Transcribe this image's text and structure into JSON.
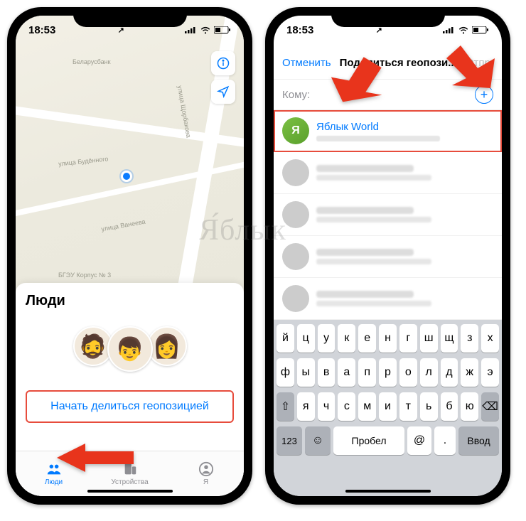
{
  "status": {
    "time": "18:53",
    "network_arrow": "↗"
  },
  "leftPhone": {
    "map": {
      "poi_bank": "Беларусбанк",
      "street1": "улица Будённого",
      "street2": "улица Ванеева",
      "street3": "улица Щорбакова",
      "poi_uni": "БГЭУ Корпус № 3"
    },
    "sheet_title": "Люди",
    "share_button": "Начать делиться геопозицией",
    "tabs": {
      "people": "Люди",
      "devices": "Устройства",
      "me": "Я"
    }
  },
  "rightPhone": {
    "nav": {
      "cancel": "Отменить",
      "title": "Поделиться геопози...",
      "send": "Отпр."
    },
    "to_label": "Кому:",
    "to_value": "",
    "contacts": [
      {
        "name": "Яблык World",
        "detail": "домашний yablyk@gmail.com",
        "green": true,
        "highlight": true
      },
      {
        "blur": true
      },
      {
        "blur": true
      },
      {
        "blur": true
      },
      {
        "blur": true
      },
      {
        "blur": true
      }
    ],
    "keyboard": {
      "row1": [
        "й",
        "ц",
        "у",
        "к",
        "е",
        "н",
        "г",
        "ш",
        "щ",
        "з",
        "х"
      ],
      "row2": [
        "ф",
        "ы",
        "в",
        "а",
        "п",
        "р",
        "о",
        "л",
        "д",
        "ж",
        "э"
      ],
      "row3": [
        "я",
        "ч",
        "с",
        "м",
        "и",
        "т",
        "ь",
        "б",
        "ю"
      ],
      "shift": "⇧",
      "del": "⌫",
      "num": "123",
      "emoji": "☺",
      "space": "Пробел",
      "at": "@",
      "dot": ".",
      "enter": "Ввод"
    }
  },
  "watermark": "Я́блык"
}
